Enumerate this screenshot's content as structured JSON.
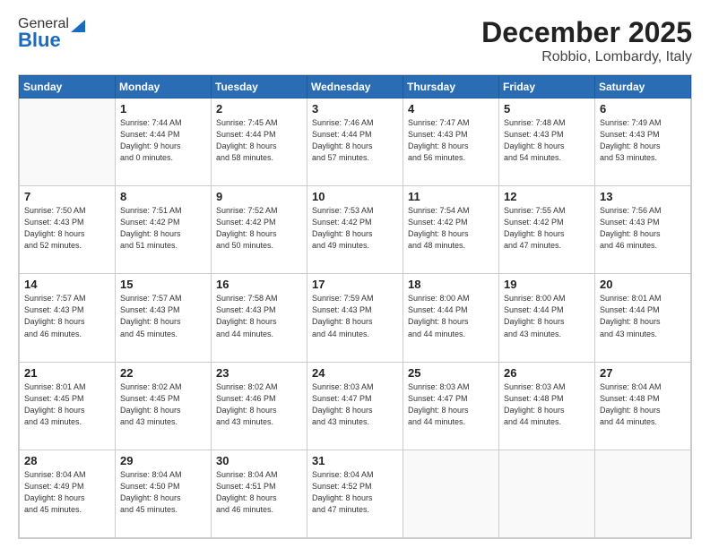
{
  "header": {
    "logo_general": "General",
    "logo_blue": "Blue",
    "title": "December 2025",
    "subtitle": "Robbio, Lombardy, Italy"
  },
  "days_of_week": [
    "Sunday",
    "Monday",
    "Tuesday",
    "Wednesday",
    "Thursday",
    "Friday",
    "Saturday"
  ],
  "weeks": [
    [
      {
        "day": "",
        "info": ""
      },
      {
        "day": "1",
        "info": "Sunrise: 7:44 AM\nSunset: 4:44 PM\nDaylight: 9 hours\nand 0 minutes."
      },
      {
        "day": "2",
        "info": "Sunrise: 7:45 AM\nSunset: 4:44 PM\nDaylight: 8 hours\nand 58 minutes."
      },
      {
        "day": "3",
        "info": "Sunrise: 7:46 AM\nSunset: 4:44 PM\nDaylight: 8 hours\nand 57 minutes."
      },
      {
        "day": "4",
        "info": "Sunrise: 7:47 AM\nSunset: 4:43 PM\nDaylight: 8 hours\nand 56 minutes."
      },
      {
        "day": "5",
        "info": "Sunrise: 7:48 AM\nSunset: 4:43 PM\nDaylight: 8 hours\nand 54 minutes."
      },
      {
        "day": "6",
        "info": "Sunrise: 7:49 AM\nSunset: 4:43 PM\nDaylight: 8 hours\nand 53 minutes."
      }
    ],
    [
      {
        "day": "7",
        "info": "Sunrise: 7:50 AM\nSunset: 4:43 PM\nDaylight: 8 hours\nand 52 minutes."
      },
      {
        "day": "8",
        "info": "Sunrise: 7:51 AM\nSunset: 4:42 PM\nDaylight: 8 hours\nand 51 minutes."
      },
      {
        "day": "9",
        "info": "Sunrise: 7:52 AM\nSunset: 4:42 PM\nDaylight: 8 hours\nand 50 minutes."
      },
      {
        "day": "10",
        "info": "Sunrise: 7:53 AM\nSunset: 4:42 PM\nDaylight: 8 hours\nand 49 minutes."
      },
      {
        "day": "11",
        "info": "Sunrise: 7:54 AM\nSunset: 4:42 PM\nDaylight: 8 hours\nand 48 minutes."
      },
      {
        "day": "12",
        "info": "Sunrise: 7:55 AM\nSunset: 4:42 PM\nDaylight: 8 hours\nand 47 minutes."
      },
      {
        "day": "13",
        "info": "Sunrise: 7:56 AM\nSunset: 4:43 PM\nDaylight: 8 hours\nand 46 minutes."
      }
    ],
    [
      {
        "day": "14",
        "info": "Sunrise: 7:57 AM\nSunset: 4:43 PM\nDaylight: 8 hours\nand 46 minutes."
      },
      {
        "day": "15",
        "info": "Sunrise: 7:57 AM\nSunset: 4:43 PM\nDaylight: 8 hours\nand 45 minutes."
      },
      {
        "day": "16",
        "info": "Sunrise: 7:58 AM\nSunset: 4:43 PM\nDaylight: 8 hours\nand 44 minutes."
      },
      {
        "day": "17",
        "info": "Sunrise: 7:59 AM\nSunset: 4:43 PM\nDaylight: 8 hours\nand 44 minutes."
      },
      {
        "day": "18",
        "info": "Sunrise: 8:00 AM\nSunset: 4:44 PM\nDaylight: 8 hours\nand 44 minutes."
      },
      {
        "day": "19",
        "info": "Sunrise: 8:00 AM\nSunset: 4:44 PM\nDaylight: 8 hours\nand 43 minutes."
      },
      {
        "day": "20",
        "info": "Sunrise: 8:01 AM\nSunset: 4:44 PM\nDaylight: 8 hours\nand 43 minutes."
      }
    ],
    [
      {
        "day": "21",
        "info": "Sunrise: 8:01 AM\nSunset: 4:45 PM\nDaylight: 8 hours\nand 43 minutes."
      },
      {
        "day": "22",
        "info": "Sunrise: 8:02 AM\nSunset: 4:45 PM\nDaylight: 8 hours\nand 43 minutes."
      },
      {
        "day": "23",
        "info": "Sunrise: 8:02 AM\nSunset: 4:46 PM\nDaylight: 8 hours\nand 43 minutes."
      },
      {
        "day": "24",
        "info": "Sunrise: 8:03 AM\nSunset: 4:47 PM\nDaylight: 8 hours\nand 43 minutes."
      },
      {
        "day": "25",
        "info": "Sunrise: 8:03 AM\nSunset: 4:47 PM\nDaylight: 8 hours\nand 44 minutes."
      },
      {
        "day": "26",
        "info": "Sunrise: 8:03 AM\nSunset: 4:48 PM\nDaylight: 8 hours\nand 44 minutes."
      },
      {
        "day": "27",
        "info": "Sunrise: 8:04 AM\nSunset: 4:48 PM\nDaylight: 8 hours\nand 44 minutes."
      }
    ],
    [
      {
        "day": "28",
        "info": "Sunrise: 8:04 AM\nSunset: 4:49 PM\nDaylight: 8 hours\nand 45 minutes."
      },
      {
        "day": "29",
        "info": "Sunrise: 8:04 AM\nSunset: 4:50 PM\nDaylight: 8 hours\nand 45 minutes."
      },
      {
        "day": "30",
        "info": "Sunrise: 8:04 AM\nSunset: 4:51 PM\nDaylight: 8 hours\nand 46 minutes."
      },
      {
        "day": "31",
        "info": "Sunrise: 8:04 AM\nSunset: 4:52 PM\nDaylight: 8 hours\nand 47 minutes."
      },
      {
        "day": "",
        "info": ""
      },
      {
        "day": "",
        "info": ""
      },
      {
        "day": "",
        "info": ""
      }
    ]
  ]
}
